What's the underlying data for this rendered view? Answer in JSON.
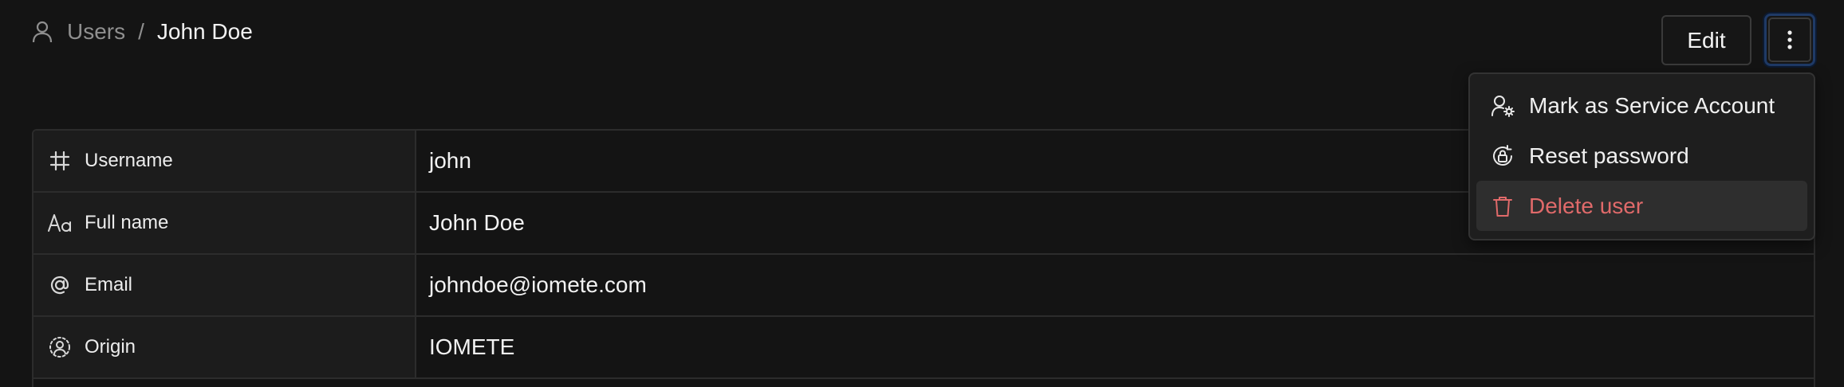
{
  "breadcrumb": {
    "icon": "user-icon",
    "parent": "Users",
    "separator": "/",
    "current": "John Doe"
  },
  "header": {
    "edit_label": "Edit",
    "more_icon": "vertical-ellipsis-icon"
  },
  "details": [
    {
      "icon": "hash-icon",
      "label": "Username",
      "value": "john"
    },
    {
      "icon": "text-icon",
      "label": "Full name",
      "value": "John Doe"
    },
    {
      "icon": "at-sign-icon",
      "label": "Email",
      "value": "johndoe@iomete.com"
    },
    {
      "icon": "user-circle-icon",
      "label": "Origin",
      "value": "IOMETE"
    }
  ],
  "menu": {
    "items": [
      {
        "icon": "user-cog-icon",
        "label": "Mark as Service Account"
      },
      {
        "icon": "lock-reset-icon",
        "label": "Reset password"
      },
      {
        "icon": "trash-icon",
        "label": "Delete user",
        "danger": true
      }
    ]
  },
  "colors": {
    "background": "#141414",
    "label_cell": "#1c1c1c",
    "border": "#2c2c2c",
    "danger": "#e06a6a",
    "focus_ring": "#1f3a66"
  }
}
